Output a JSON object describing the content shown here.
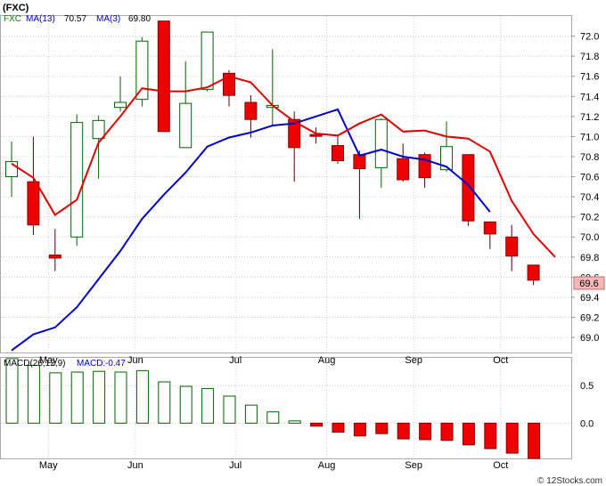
{
  "chart_data": [
    {
      "type": "candlestick",
      "symbol": "(FXC)",
      "legend": [
        {
          "label": "FXC",
          "color": "#008000"
        },
        {
          "label": "MA(13)",
          "value": "70.57",
          "color": "#0000cc"
        },
        {
          "label": "MA(3)",
          "value": "69.80",
          "color": "#cc0000"
        }
      ],
      "ylim": [
        68.85,
        72.2
      ],
      "y_ticks": [
        "72.0",
        "71.8",
        "71.6",
        "71.4",
        "71.2",
        "71.0",
        "70.8",
        "70.6",
        "70.4",
        "70.2",
        "70.0",
        "69.8",
        "69.6",
        "69.4",
        "69.2",
        "69.0"
      ],
      "last_price_label": "69.6",
      "x_labels": [
        {
          "label": "May",
          "at": 1.2
        },
        {
          "label": "Jun",
          "at": 5.2
        },
        {
          "label": "Jul",
          "at": 9.8
        },
        {
          "label": "Aug",
          "at": 14.0
        },
        {
          "label": "Sep",
          "at": 18.0
        },
        {
          "label": "Oct",
          "at": 22.0
        }
      ],
      "candles": [
        {
          "o": 70.6,
          "h": 70.95,
          "l": 70.4,
          "c": 70.75
        },
        {
          "o": 70.55,
          "h": 71.0,
          "l": 70.02,
          "c": 70.12
        },
        {
          "o": 69.82,
          "h": 70.08,
          "l": 69.66,
          "c": 69.79
        },
        {
          "o": 70.0,
          "h": 71.22,
          "l": 69.91,
          "c": 71.14
        },
        {
          "o": 70.98,
          "h": 71.21,
          "l": 70.58,
          "c": 71.16
        },
        {
          "o": 71.29,
          "h": 71.6,
          "l": 71.25,
          "c": 71.34
        },
        {
          "o": 71.37,
          "h": 71.99,
          "l": 71.3,
          "c": 71.95
        },
        {
          "o": 72.15,
          "h": 72.15,
          "l": 71.05,
          "c": 71.05
        },
        {
          "o": 70.89,
          "h": 71.75,
          "l": 70.89,
          "c": 71.33
        },
        {
          "o": 71.47,
          "h": 72.04,
          "l": 71.45,
          "c": 72.04
        },
        {
          "o": 71.63,
          "h": 71.66,
          "l": 71.3,
          "c": 71.41
        },
        {
          "o": 71.34,
          "h": 71.41,
          "l": 70.99,
          "c": 71.17
        },
        {
          "o": 71.29,
          "h": 71.87,
          "l": 71.1,
          "c": 71.31
        },
        {
          "o": 71.17,
          "h": 71.25,
          "l": 70.55,
          "c": 70.89
        },
        {
          "o": 71.02,
          "h": 71.09,
          "l": 70.93,
          "c": 71.01
        },
        {
          "o": 70.91,
          "h": 71.0,
          "l": 70.73,
          "c": 70.76
        },
        {
          "o": 70.82,
          "h": 70.86,
          "l": 70.18,
          "c": 70.68
        },
        {
          "o": 70.69,
          "h": 71.18,
          "l": 70.49,
          "c": 71.17
        },
        {
          "o": 70.78,
          "h": 70.93,
          "l": 70.55,
          "c": 70.57
        },
        {
          "o": 70.82,
          "h": 70.84,
          "l": 70.49,
          "c": 70.59
        },
        {
          "o": 70.67,
          "h": 71.15,
          "l": 70.65,
          "c": 70.9
        },
        {
          "o": 70.82,
          "h": 70.82,
          "l": 70.11,
          "c": 70.16
        },
        {
          "o": 70.15,
          "h": 70.15,
          "l": 69.88,
          "c": 70.03
        },
        {
          "o": 70.0,
          "h": 70.12,
          "l": 69.66,
          "c": 69.81
        },
        {
          "o": 69.72,
          "h": 69.72,
          "l": 69.52,
          "c": 69.57
        }
      ],
      "ma13": [
        [
          0,
          68.87
        ],
        [
          1,
          69.03
        ],
        [
          2,
          69.1
        ],
        [
          3,
          69.3
        ],
        [
          4,
          69.58
        ],
        [
          5,
          69.86
        ],
        [
          6,
          70.18
        ],
        [
          7,
          70.42
        ],
        [
          8,
          70.64
        ],
        [
          9,
          70.9
        ],
        [
          10,
          70.99
        ],
        [
          11,
          71.04
        ],
        [
          12,
          71.11
        ],
        [
          13,
          71.13
        ],
        [
          14,
          71.2
        ],
        [
          15,
          71.27
        ],
        [
          16,
          70.81
        ],
        [
          17,
          70.87
        ],
        [
          18,
          70.8
        ],
        [
          19,
          70.77
        ],
        [
          20,
          70.7
        ],
        [
          21,
          70.52
        ],
        [
          22,
          70.25
        ]
      ],
      "ma3": [
        [
          0,
          70.73
        ],
        [
          1,
          70.59
        ],
        [
          2,
          70.22
        ],
        [
          3,
          70.37
        ],
        [
          4,
          70.94
        ],
        [
          5,
          71.2
        ],
        [
          6,
          71.48
        ],
        [
          7,
          71.45
        ],
        [
          8,
          71.45
        ],
        [
          9,
          71.49
        ],
        [
          10,
          71.6
        ],
        [
          11,
          71.54
        ],
        [
          12,
          71.31
        ],
        [
          13,
          71.15
        ],
        [
          14,
          71.03
        ],
        [
          15,
          71.01
        ],
        [
          16,
          71.13
        ],
        [
          17,
          71.22
        ],
        [
          18,
          71.05
        ],
        [
          19,
          71.06
        ],
        [
          20,
          71.0
        ],
        [
          21,
          70.98
        ],
        [
          22,
          70.85
        ],
        [
          23,
          70.36
        ],
        [
          24,
          70.03
        ],
        [
          25,
          69.8
        ]
      ]
    },
    {
      "type": "bar",
      "name": "MACD(26,12,9)",
      "legend": [
        {
          "label": "MACD(26,12,9)",
          "color": "#000000"
        },
        {
          "label": "MACD:",
          "value": "-0.47",
          "color": "#0000cc"
        }
      ],
      "ylim": [
        -0.47,
        0.87
      ],
      "y_ticks": [
        "0.5",
        "0.0"
      ],
      "x_labels": [
        "May",
        "Jun",
        "Jul",
        "Aug",
        "Sep",
        "Oct"
      ],
      "values": [
        0.86,
        0.77,
        0.67,
        0.68,
        0.69,
        0.68,
        0.7,
        0.55,
        0.49,
        0.46,
        0.36,
        0.24,
        0.15,
        0.03,
        -0.04,
        -0.12,
        -0.17,
        -0.14,
        -0.21,
        -0.22,
        -0.23,
        -0.29,
        -0.34,
        -0.4,
        -0.47
      ]
    }
  ],
  "watermark": "© 12Stocks.com"
}
